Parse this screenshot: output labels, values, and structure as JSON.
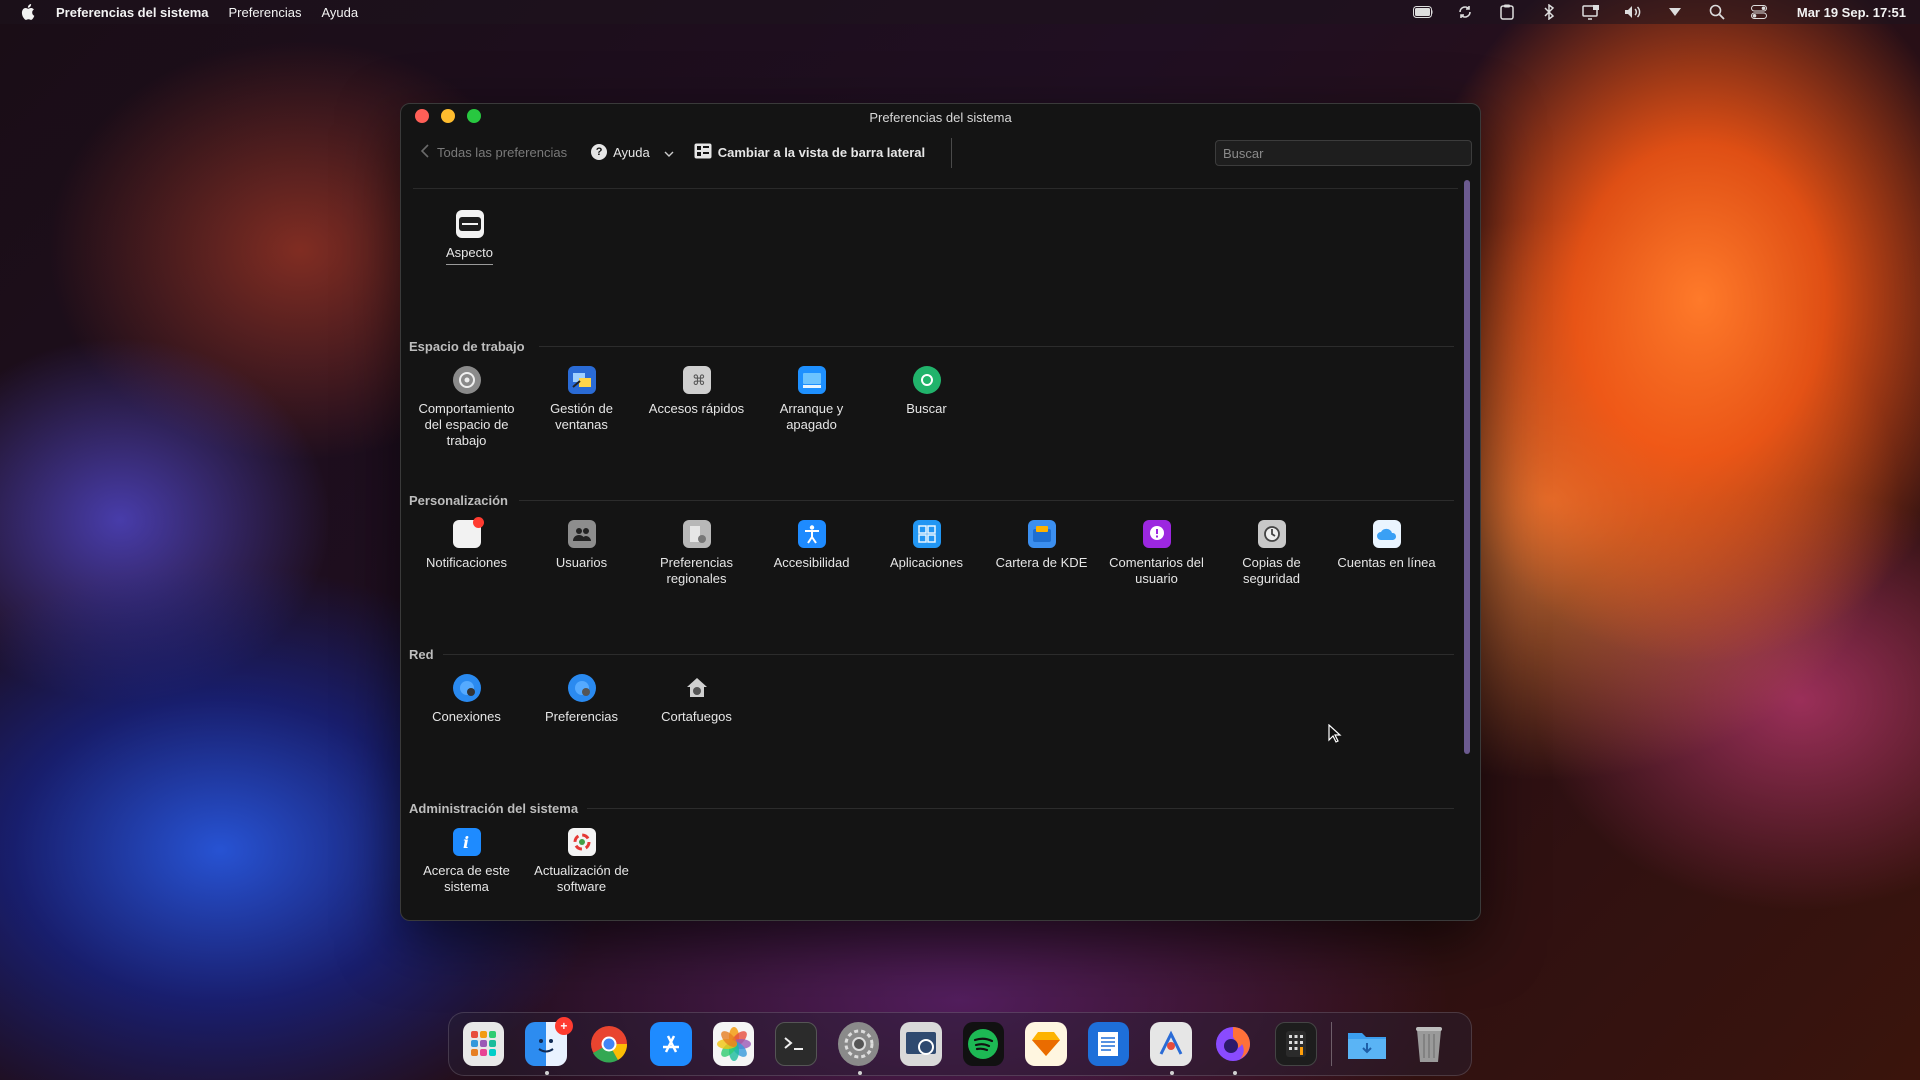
{
  "menubar": {
    "app_name": "Preferencias del sistema",
    "menus": [
      "Preferencias",
      "Ayuda"
    ],
    "clock": "Mar 19 Sep. 17:51",
    "status_icons": [
      "battery-icon",
      "sync-icon",
      "clipboard-icon",
      "bluetooth-icon",
      "display-icon",
      "volume-icon",
      "chevron-down-icon",
      "search-icon",
      "control-center-icon"
    ]
  },
  "window": {
    "title": "Preferencias del sistema",
    "toolbar": {
      "back_label": "Todas las preferencias",
      "help_label": "Ayuda",
      "sidebar_label": "Cambiar a la vista de barra lateral",
      "search_placeholder": "Buscar"
    },
    "top_item": {
      "label": "Aspecto",
      "icon": "appearance-icon"
    },
    "sections": [
      {
        "title": "Espacio de trabajo",
        "items": [
          {
            "label": "Comportamiento del espacio de trabajo",
            "icon": "workspace-behavior-icon",
            "color": "#8a8a8a"
          },
          {
            "label": "Gestión de ventanas",
            "icon": "window-management-icon",
            "color": "#2a6bd6"
          },
          {
            "label": "Accesos rápidos",
            "icon": "shortcuts-icon",
            "color": "#cfcfcf"
          },
          {
            "label": "Arranque y apagado",
            "icon": "startup-shutdown-icon",
            "color": "#1e90ff"
          },
          {
            "label": "Buscar",
            "icon": "search-icon",
            "color": "#21b36b"
          }
        ]
      },
      {
        "title": "Personalización",
        "items": [
          {
            "label": "Notificaciones",
            "icon": "notifications-icon",
            "color": "#f2f2f2"
          },
          {
            "label": "Usuarios",
            "icon": "users-icon",
            "color": "#8d8d8d"
          },
          {
            "label": "Preferencias regionales",
            "icon": "regional-icon",
            "color": "#b8b8b8"
          },
          {
            "label": "Accesibilidad",
            "icon": "accessibility-icon",
            "color": "#1e8bff"
          },
          {
            "label": "Aplicaciones",
            "icon": "applications-icon",
            "color": "#2196f3"
          },
          {
            "label": "Cartera de KDE",
            "icon": "kde-wallet-icon",
            "color": "#3b8ff0"
          },
          {
            "label": "Comentarios del usuario",
            "icon": "feedback-icon",
            "color": "#9c27e0"
          },
          {
            "label": "Copias de seguridad",
            "icon": "backup-icon",
            "color": "#c8c8c8"
          },
          {
            "label": "Cuentas en línea",
            "icon": "online-accounts-icon",
            "color": "#5ab4f5"
          }
        ]
      },
      {
        "title": "Red",
        "items": [
          {
            "label": "Conexiones",
            "icon": "connections-icon",
            "color": "#2a8af0"
          },
          {
            "label": "Preferencias",
            "icon": "network-preferences-icon",
            "color": "#2a8af0"
          },
          {
            "label": "Cortafuegos",
            "icon": "firewall-icon",
            "color": "#6f6f6f"
          }
        ]
      },
      {
        "title": "Administración del sistema",
        "items": [
          {
            "label": "Acerca de este sistema",
            "icon": "info-icon",
            "color": "#1e8bff"
          },
          {
            "label": "Actualización de software",
            "icon": "software-update-icon",
            "color": "#f4f4f4"
          }
        ]
      }
    ]
  },
  "dock": {
    "apps": [
      {
        "name": "launchpad-icon",
        "color": "#e8e8e8",
        "running": false
      },
      {
        "name": "finder-icon",
        "color": "#2d8cf0",
        "running": true,
        "badge": "+"
      },
      {
        "name": "chrome-icon",
        "color": "#e9442f",
        "running": false
      },
      {
        "name": "app-store-icon",
        "color": "#1e8bff",
        "running": false
      },
      {
        "name": "photos-icon",
        "color": "#f5f5f5",
        "running": false
      },
      {
        "name": "terminal-icon",
        "color": "#2b2b2b",
        "running": false
      },
      {
        "name": "system-preferences-icon",
        "color": "#8a8a8a",
        "running": true
      },
      {
        "name": "preview-icon",
        "color": "#d9d9d9",
        "running": false
      },
      {
        "name": "spotify-icon",
        "color": "#1db954",
        "running": false
      },
      {
        "name": "sketch-icon",
        "color": "#fdb300",
        "running": false
      },
      {
        "name": "textedit-icon",
        "color": "#1e6fd9",
        "running": false
      },
      {
        "name": "preview-viewer-icon",
        "color": "#e6e6e6",
        "running": true
      },
      {
        "name": "firefox-icon",
        "color": "#8a4bff",
        "running": true
      },
      {
        "name": "calculator-icon",
        "color": "#e5e5e5",
        "running": false
      }
    ],
    "trailing": [
      {
        "name": "downloads-folder-icon",
        "color": "#5ab4f5"
      },
      {
        "name": "trash-icon",
        "color": "#9a9a9a"
      }
    ]
  }
}
